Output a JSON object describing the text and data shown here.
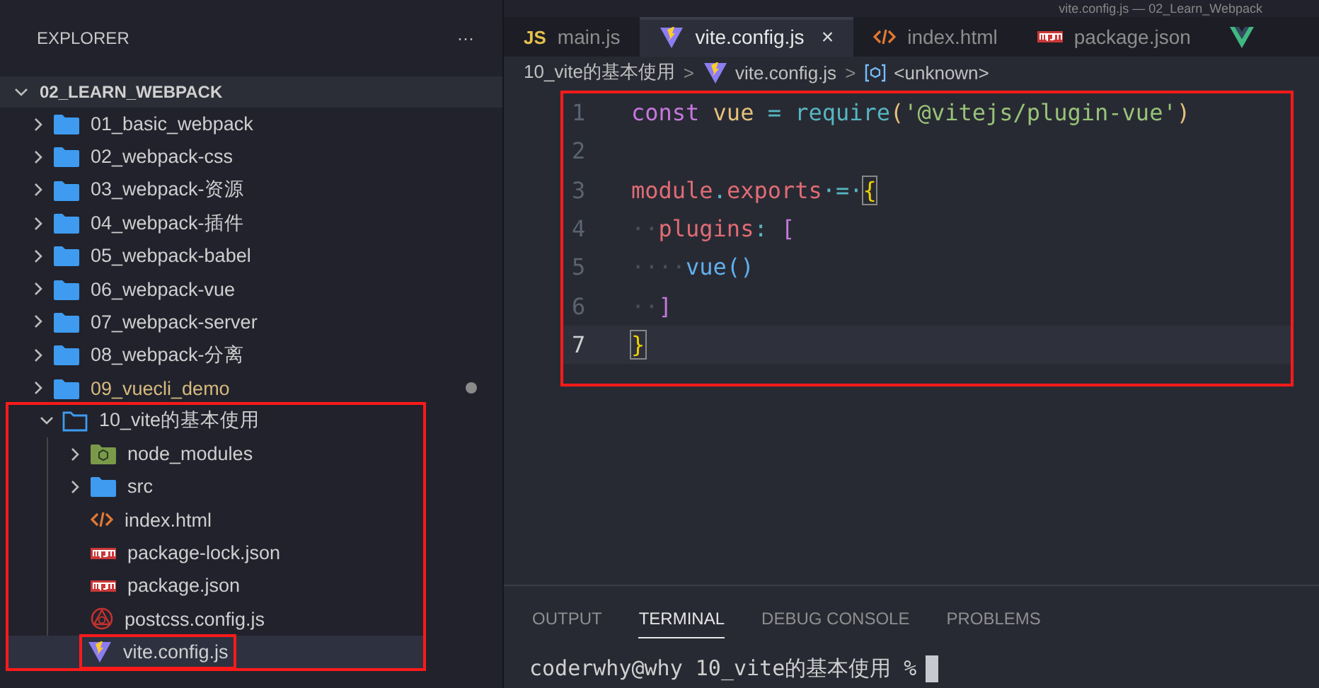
{
  "window": {
    "title": "vite.config.js — 02_Learn_Webpack"
  },
  "sidebar": {
    "title": "EXPLORER",
    "more": "···",
    "root": {
      "label": "02_LEARN_WEBPACK",
      "expanded": true
    },
    "items": [
      {
        "label": "01_basic_webpack",
        "kind": "folder",
        "expanded": false,
        "selected": false
      },
      {
        "label": "02_webpack-css",
        "kind": "folder",
        "expanded": false,
        "selected": false
      },
      {
        "label": "03_webpack-资源",
        "kind": "folder",
        "expanded": false,
        "selected": false
      },
      {
        "label": "04_webpack-插件",
        "kind": "folder",
        "expanded": false,
        "selected": false
      },
      {
        "label": "05_webpack-babel",
        "kind": "folder",
        "expanded": false,
        "selected": false
      },
      {
        "label": "06_webpack-vue",
        "kind": "folder",
        "expanded": false,
        "selected": false
      },
      {
        "label": "07_webpack-server",
        "kind": "folder",
        "expanded": false,
        "selected": false
      },
      {
        "label": "08_webpack-分离",
        "kind": "folder",
        "expanded": false,
        "selected": false
      },
      {
        "label": "09_vuecli_demo",
        "kind": "folder",
        "expanded": false,
        "selected": false,
        "modified": true
      },
      {
        "label": "10_vite的基本使用",
        "kind": "folder",
        "expanded": true,
        "selected": false,
        "annotated": true,
        "children": [
          {
            "label": "node_modules",
            "kind": "node-folder",
            "expanded": false,
            "selected": false
          },
          {
            "label": "src",
            "kind": "folder",
            "expanded": false,
            "selected": false
          },
          {
            "label": "index.html",
            "kind": "html",
            "selected": false
          },
          {
            "label": "package-lock.json",
            "kind": "npm",
            "selected": false
          },
          {
            "label": "package.json",
            "kind": "npm",
            "selected": false
          },
          {
            "label": "postcss.config.js",
            "kind": "postcss",
            "selected": false
          },
          {
            "label": "vite.config.js",
            "kind": "vite",
            "selected": true,
            "annotated": true
          }
        ]
      }
    ]
  },
  "tabs": [
    {
      "label": "main.js",
      "kind": "js",
      "icon_text": "JS",
      "selected": false
    },
    {
      "label": "vite.config.js",
      "kind": "vite",
      "selected": true,
      "close": "×"
    },
    {
      "label": "index.html",
      "kind": "html",
      "selected": false
    },
    {
      "label": "package.json",
      "kind": "npm",
      "selected": false
    },
    {
      "kind": "vue",
      "selected": false
    }
  ],
  "breadcrumb": [
    {
      "label": "10_vite的基本使用",
      "kind": "folder"
    },
    {
      "separator": ">",
      "label": "vite.config.js",
      "kind": "vite"
    },
    {
      "separator": ">",
      "label": "<unknown>",
      "kind": "symbol"
    }
  ],
  "editor": {
    "annotated": true,
    "lines": [
      {
        "number": "1",
        "current": false,
        "tokens": [
          {
            "text": "const ",
            "kind": "keyword"
          },
          {
            "text": "vue ",
            "kind": "variable"
          },
          {
            "text": "= ",
            "kind": "operator"
          },
          {
            "text": "require",
            "kind": "function"
          },
          {
            "text": "(",
            "kind": "paren"
          },
          {
            "text": "'@vitejs/plugin-vue'",
            "kind": "string"
          },
          {
            "text": ")",
            "kind": "paren"
          }
        ]
      },
      {
        "number": "2",
        "current": false
      },
      {
        "number": "3",
        "current": false,
        "tokens": [
          {
            "text": "module",
            "kind": "property"
          },
          {
            "text": ".",
            "kind": "operator"
          },
          {
            "text": "exports",
            "kind": "property"
          },
          {
            "text": "·=·",
            "kind": "operator"
          },
          {
            "text": "{",
            "kind": "brace-match"
          }
        ]
      },
      {
        "number": "4",
        "current": false,
        "tokens": [
          {
            "text": "··",
            "kind": "whitespace"
          },
          {
            "text": "plugins",
            "kind": "property"
          },
          {
            "text": ": ",
            "kind": "operator"
          },
          {
            "text": "[",
            "kind": "bracket"
          }
        ]
      },
      {
        "number": "5",
        "current": false,
        "tokens": [
          {
            "text": "····",
            "kind": "whitespace"
          },
          {
            "text": "vue",
            "kind": "call"
          },
          {
            "text": "()",
            "kind": "paren-blue"
          }
        ]
      },
      {
        "number": "6",
        "current": false,
        "tokens": [
          {
            "text": "··",
            "kind": "whitespace"
          },
          {
            "text": "]",
            "kind": "bracket"
          }
        ]
      },
      {
        "number": "7",
        "current": true,
        "tokens": [
          {
            "text": "}",
            "kind": "brace-match"
          }
        ]
      }
    ]
  },
  "panel": {
    "tabs": [
      {
        "label": "OUTPUT",
        "selected": false
      },
      {
        "label": "TERMINAL",
        "selected": true
      },
      {
        "label": "DEBUG CONSOLE",
        "selected": false
      },
      {
        "label": "PROBLEMS",
        "selected": false
      }
    ],
    "terminal": {
      "prompt": "coderwhy@why 10_vite的基本使用 %"
    }
  }
}
